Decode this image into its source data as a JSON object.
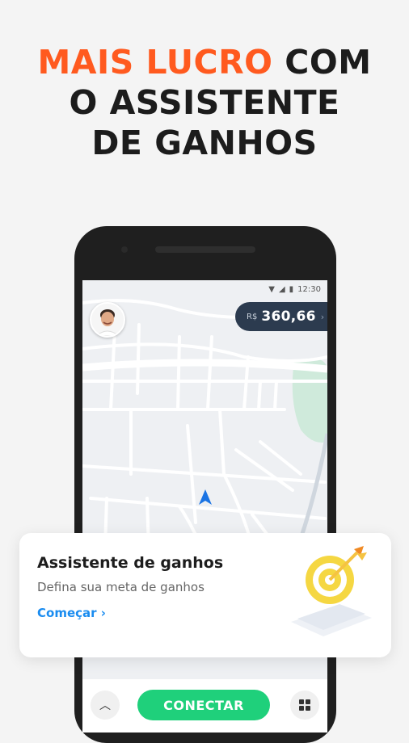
{
  "headline": {
    "line1_accent": "MAIS LUCRO",
    "line1_rest": " COM",
    "line2": "O ASSISTENTE",
    "line3": "DE GANHOS",
    "accent_color": "#ff5a1f"
  },
  "status_bar": {
    "time": "12:30",
    "icons": [
      "wifi-icon",
      "signal-icon",
      "battery-icon"
    ]
  },
  "earnings": {
    "currency": "R$",
    "amount": "360,66"
  },
  "card": {
    "title": "Assistente de ganhos",
    "subtitle": "Defina sua meta de ganhos",
    "link_label": "Começar",
    "link_color": "#1a8cf0"
  },
  "bottom_bar": {
    "connect_label": "CONECTAR",
    "connect_color": "#1fd07b"
  }
}
